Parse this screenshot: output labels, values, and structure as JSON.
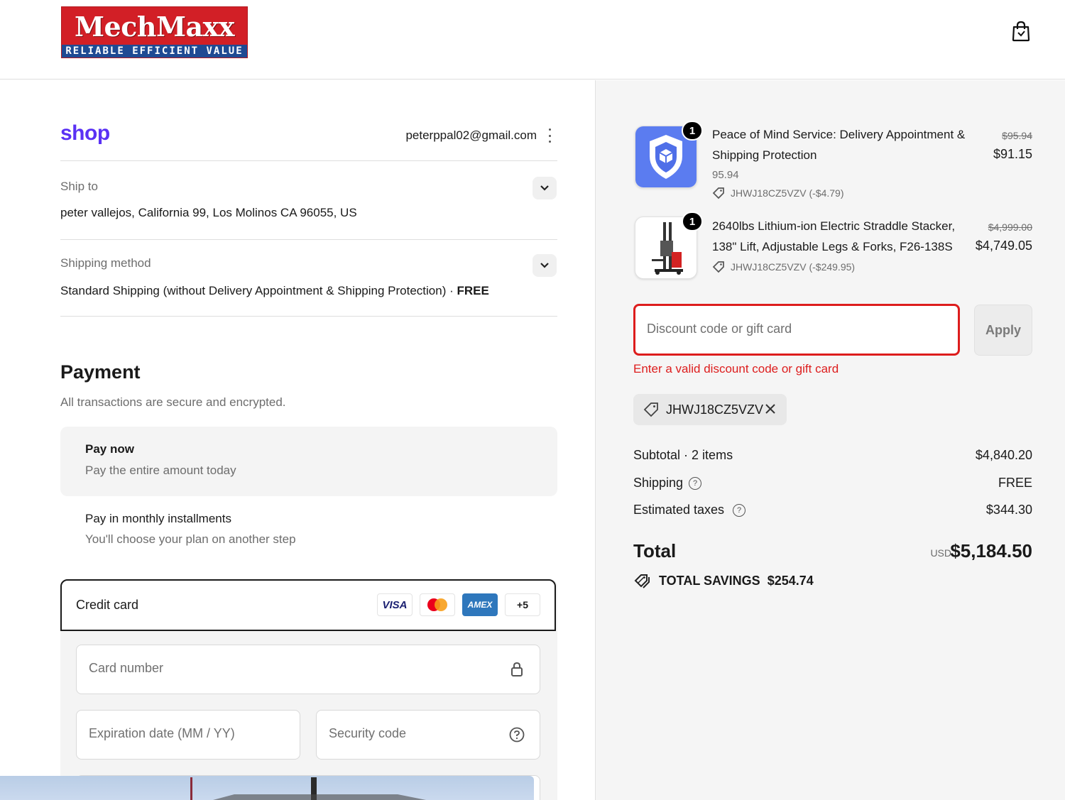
{
  "header": {
    "brand_name": "MechMaxx",
    "brand_tagline": "RELIABLE EFFICIENT VALUE",
    "cart_icon": "shopping-bag-icon"
  },
  "account": {
    "shop_logo": "shop",
    "email": "peterppal02@gmail.com"
  },
  "ship_to": {
    "label": "Ship to",
    "value": "peter vallejos, California 99, Los Molinos CA 96055, US"
  },
  "shipping_method": {
    "label": "Shipping method",
    "value": "Standard Shipping (without Delivery Appointment & Shipping Protection)",
    "separator": " · ",
    "price": "FREE"
  },
  "payment": {
    "title": "Payment",
    "subtitle": "All transactions are secure and encrypted.",
    "options": [
      {
        "title": "Pay now",
        "subtitle": "Pay the entire amount today"
      },
      {
        "title": "Pay in monthly installments",
        "subtitle": "You'll choose your plan on another step"
      }
    ],
    "credit_card": {
      "label": "Credit card",
      "brands": [
        "VISA",
        "Mastercard",
        "AMEX"
      ],
      "more": "+5",
      "card_number_placeholder": "Card number",
      "expiry_placeholder": "Expiration date (MM / YY)",
      "security_placeholder": "Security code"
    }
  },
  "order": {
    "items": [
      {
        "qty": "1",
        "title_line1": "Peace of Mind Service: Delivery Appointment &",
        "title_line2": "Shipping Protection",
        "variant": "95.94",
        "discount": "JHWJ18CZ5VZV (-$4.79)",
        "old_price": "$95.94",
        "price": "$91.15",
        "icon": "shield-box-icon"
      },
      {
        "qty": "1",
        "title_line1": "2640lbs Lithium-ion Electric Straddle Stacker,",
        "title_line2": "138\" Lift, Adjustable Legs & Forks, F26-138S",
        "discount": "JHWJ18CZ5VZV (-$249.95)",
        "old_price": "$4,999.00",
        "price": "$4,749.05",
        "icon": "stacker-image"
      }
    ],
    "discount_placeholder": "Discount code or gift card",
    "apply_label": "Apply",
    "discount_error": "Enter a valid discount code or gift card",
    "applied_code": "JHWJ18CZ5VZV",
    "subtotal_label": "Subtotal · 2 items",
    "subtotal": "$4,840.20",
    "shipping_label": "Shipping",
    "shipping": "FREE",
    "taxes_label": "Estimated taxes",
    "taxes": "$344.30",
    "total_label": "Total",
    "currency": "USD",
    "total": "$5,184.50",
    "savings_label": "TOTAL SAVINGS",
    "savings": "$254.74"
  },
  "colors": {
    "brand_red": "#d21f26",
    "brand_blue": "#1f4a93",
    "shop_purple": "#5a31f4",
    "error_red": "#dd1d1d"
  }
}
